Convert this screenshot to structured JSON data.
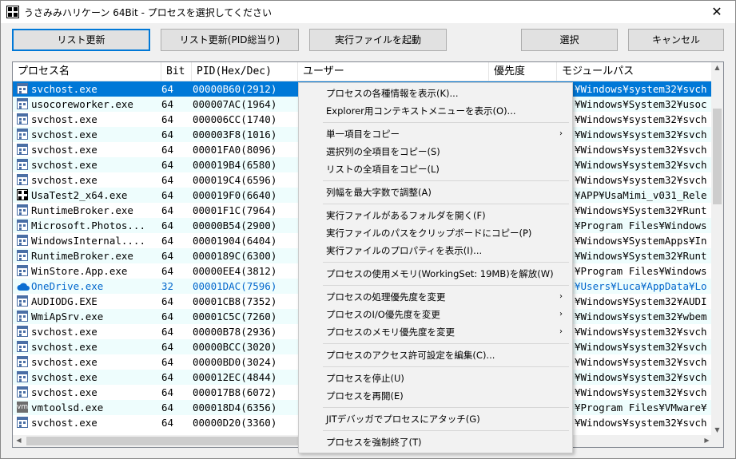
{
  "window": {
    "title": "うさみみハリケーン 64Bit - プロセスを選択してください",
    "close_glyph": "✕",
    "app_icon": "usamimi-app-icon"
  },
  "toolbar": {
    "refresh": "リスト更新",
    "refresh_pid": "リスト更新(PID総当り)",
    "launch": "実行ファイルを起動",
    "select": "選択",
    "cancel": "キャンセル"
  },
  "columns": [
    "プロセス名",
    "Bit",
    "PID(Hex/Dec)",
    "ユーザー",
    "優先度",
    "モジュールパス"
  ],
  "rows": [
    {
      "name": "svchost.exe",
      "bit": "64",
      "pid": "00000B60(2912)",
      "path": "¥Windows¥system32¥svch",
      "icon": "generic-process-icon",
      "selected": true
    },
    {
      "name": "usocoreworker.exe",
      "bit": "64",
      "pid": "000007AC(1964)",
      "path": "¥Windows¥System32¥usoc",
      "icon": "generic-process-icon"
    },
    {
      "name": "svchost.exe",
      "bit": "64",
      "pid": "000006CC(1740)",
      "path": "¥Windows¥system32¥svch",
      "icon": "generic-process-icon"
    },
    {
      "name": "svchost.exe",
      "bit": "64",
      "pid": "000003F8(1016)",
      "path": "¥Windows¥system32¥svch",
      "icon": "generic-process-icon"
    },
    {
      "name": "svchost.exe",
      "bit": "64",
      "pid": "00001FA0(8096)",
      "path": "¥Windows¥system32¥svch",
      "icon": "generic-process-icon"
    },
    {
      "name": "svchost.exe",
      "bit": "64",
      "pid": "000019B4(6580)",
      "path": "¥Windows¥system32¥svch",
      "icon": "generic-process-icon"
    },
    {
      "name": "svchost.exe",
      "bit": "64",
      "pid": "000019C4(6596)",
      "path": "¥Windows¥system32¥svch",
      "icon": "generic-process-icon"
    },
    {
      "name": "UsaTest2_x64.exe",
      "bit": "64",
      "pid": "000019F0(6640)",
      "path": "¥APP¥UsaMimi_v031_Rele",
      "icon": "usamimi-app-icon"
    },
    {
      "name": "RuntimeBroker.exe",
      "bit": "64",
      "pid": "00001F1C(7964)",
      "path": "¥Windows¥System32¥Runt",
      "icon": "generic-process-icon"
    },
    {
      "name": "Microsoft.Photos...",
      "bit": "64",
      "pid": "00000B54(2900)",
      "path": "¥Program Files¥Windows",
      "icon": "generic-process-icon"
    },
    {
      "name": "WindowsInternal....",
      "bit": "64",
      "pid": "00001904(6404)",
      "path": "¥Windows¥SystemApps¥In",
      "icon": "generic-process-icon"
    },
    {
      "name": "RuntimeBroker.exe",
      "bit": "64",
      "pid": "0000189C(6300)",
      "path": "¥Windows¥System32¥Runt",
      "icon": "generic-process-icon"
    },
    {
      "name": "WinStore.App.exe",
      "bit": "64",
      "pid": "00000EE4(3812)",
      "path": "¥Program Files¥Windows",
      "icon": "generic-process-icon"
    },
    {
      "name": "OneDrive.exe",
      "bit": "32",
      "pid": "00001DAC(7596)",
      "path": "¥Users¥Luca¥AppData¥Lo",
      "icon": "onedrive-cloud-icon",
      "blue": true
    },
    {
      "name": "AUDIODG.EXE",
      "bit": "64",
      "pid": "00001CB8(7352)",
      "path": "¥Windows¥System32¥AUDI",
      "icon": "generic-process-icon"
    },
    {
      "name": "WmiApSrv.exe",
      "bit": "64",
      "pid": "00001C5C(7260)",
      "path": "¥Windows¥system32¥wbem",
      "icon": "generic-process-icon"
    },
    {
      "name": "svchost.exe",
      "bit": "64",
      "pid": "00000B78(2936)",
      "path": "¥Windows¥system32¥svch",
      "icon": "generic-process-icon"
    },
    {
      "name": "svchost.exe",
      "bit": "64",
      "pid": "00000BCC(3020)",
      "path": "¥Windows¥system32¥svch",
      "icon": "generic-process-icon"
    },
    {
      "name": "svchost.exe",
      "bit": "64",
      "pid": "00000BD0(3024)",
      "path": "¥Windows¥system32¥svch",
      "icon": "generic-process-icon"
    },
    {
      "name": "svchost.exe",
      "bit": "64",
      "pid": "000012EC(4844)",
      "path": "¥Windows¥system32¥svch",
      "icon": "generic-process-icon"
    },
    {
      "name": "svchost.exe",
      "bit": "64",
      "pid": "000017B8(6072)",
      "path": "¥Windows¥system32¥svch",
      "icon": "generic-process-icon"
    },
    {
      "name": "vmtoolsd.exe",
      "bit": "64",
      "pid": "000018D4(6356)",
      "path": "¥Program Files¥VMware¥",
      "icon": "vmware-icon"
    },
    {
      "name": "svchost.exe",
      "bit": "64",
      "pid": "00000D20(3360)",
      "path": "¥Windows¥system32¥svch",
      "icon": "generic-process-icon"
    }
  ],
  "vm_icon_text": "vm",
  "context_menu": [
    {
      "label": "プロセスの各種情報を表示(K)..."
    },
    {
      "label": "Explorer用コンテキストメニューを表示(O)..."
    },
    {
      "sep": true
    },
    {
      "label": "単一項目をコピー",
      "submenu": true
    },
    {
      "label": "選択列の全項目をコピー(S)"
    },
    {
      "label": "リストの全項目をコピー(L)"
    },
    {
      "sep": true
    },
    {
      "label": "列幅を最大字数で調整(A)"
    },
    {
      "sep": true
    },
    {
      "label": "実行ファイルがあるフォルダを開く(F)"
    },
    {
      "label": "実行ファイルのパスをクリップボードにコピー(P)"
    },
    {
      "label": "実行ファイルのプロパティを表示(I)..."
    },
    {
      "sep": true
    },
    {
      "label": "プロセスの使用メモリ(WorkingSet: 19MB)を解放(W)"
    },
    {
      "sep": true
    },
    {
      "label": "プロセスの処理優先度を変更",
      "submenu": true
    },
    {
      "label": "プロセスのI/O優先度を変更",
      "submenu": true
    },
    {
      "label": "プロセスのメモリ優先度を変更",
      "submenu": true
    },
    {
      "sep": true
    },
    {
      "label": "プロセスのアクセス許可設定を編集(C)..."
    },
    {
      "sep": true
    },
    {
      "label": "プロセスを停止(U)"
    },
    {
      "label": "プロセスを再開(E)"
    },
    {
      "sep": true
    },
    {
      "label": "JITデバッガでプロセスにアタッチ(G)"
    },
    {
      "sep": true
    },
    {
      "label": "プロセスを強制終了(T)"
    }
  ],
  "submenu_glyph": "›",
  "scroll_glyphs": {
    "up": "▲",
    "down": "▼",
    "left": "◀",
    "right": "▶"
  },
  "colors": {
    "selection": "#0078d7",
    "alt_row": "#eefdfd",
    "blue_text": "#0066cc"
  }
}
